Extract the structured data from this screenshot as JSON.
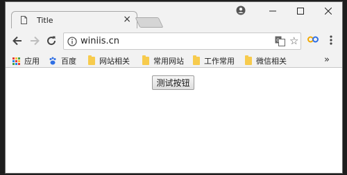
{
  "tab": {
    "title": "Title",
    "close_glyph": "×"
  },
  "window_controls": {
    "minimize": "—",
    "maximize": "☐",
    "close": "✕"
  },
  "address_bar": {
    "url": "winiis.cn"
  },
  "bookmarks": {
    "items": [
      {
        "label": "应用",
        "icon": "apps-grid-icon"
      },
      {
        "label": "百度",
        "icon": "paw-icon"
      },
      {
        "label": "网站相关",
        "icon": "folder-icon"
      },
      {
        "label": "常用网站",
        "icon": "folder-icon"
      },
      {
        "label": "工作常用",
        "icon": "folder-icon"
      },
      {
        "label": "微信相关",
        "icon": "folder-icon"
      }
    ],
    "more": "»"
  },
  "page": {
    "button_label": "测试按钮"
  },
  "colors": {
    "chrome_bg": "#f2f2f2",
    "folder": "#f7cb4d",
    "paw": "#2f6fe4",
    "ext": "#f2a900"
  }
}
